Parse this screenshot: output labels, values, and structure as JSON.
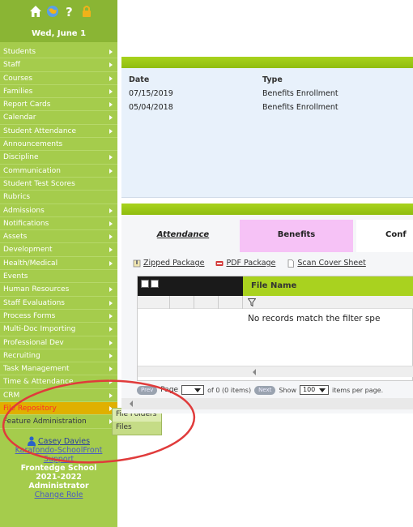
{
  "sidebar": {
    "date": "Wed, June 1",
    "items": [
      {
        "label": "Students",
        "arrow": true
      },
      {
        "label": "Staff",
        "arrow": true
      },
      {
        "label": "Courses",
        "arrow": true
      },
      {
        "label": "Families",
        "arrow": true
      },
      {
        "label": "Report Cards",
        "arrow": true
      },
      {
        "label": "Calendar",
        "arrow": true
      },
      {
        "label": "Student Attendance",
        "arrow": true
      },
      {
        "label": "Announcements",
        "arrow": false
      },
      {
        "label": "Discipline",
        "arrow": true
      },
      {
        "label": "Communication",
        "arrow": true
      },
      {
        "label": "Student Test Scores",
        "arrow": false
      },
      {
        "label": "Rubrics",
        "arrow": false
      },
      {
        "label": "Admissions",
        "arrow": true
      },
      {
        "label": "Notifications",
        "arrow": true
      },
      {
        "label": "Assets",
        "arrow": true
      },
      {
        "label": "Development",
        "arrow": true
      },
      {
        "label": "Health/Medical",
        "arrow": true
      },
      {
        "label": "Events",
        "arrow": false
      },
      {
        "label": "Human Resources",
        "arrow": true
      },
      {
        "label": "Staff Evaluations",
        "arrow": true
      },
      {
        "label": "Process Forms",
        "arrow": true
      },
      {
        "label": "Multi-Doc Importing",
        "arrow": true
      },
      {
        "label": "Professional Dev",
        "arrow": true
      },
      {
        "label": "Recruiting",
        "arrow": true
      },
      {
        "label": "Task Management",
        "arrow": true
      },
      {
        "label": "Time & Attendance",
        "arrow": true
      },
      {
        "label": "CRM",
        "arrow": true
      },
      {
        "label": "File Repository",
        "arrow": true,
        "active": true
      },
      {
        "label": "Feature Administration",
        "arrow": true,
        "dark": true
      }
    ],
    "user_name": "Casey Davies",
    "support": "Karafondo-SchoolFront Support",
    "school": "Frontedge School",
    "year": "2021-2022",
    "role": "Administrator",
    "change_role": "Change Role"
  },
  "flyout": {
    "items": [
      "File Folders",
      "Files"
    ]
  },
  "records": {
    "headers": {
      "date": "Date",
      "type": "Type"
    },
    "rows": [
      {
        "date": "07/15/2019",
        "type": "Benefits Enrollment"
      },
      {
        "date": "05/04/2018",
        "type": "Benefits Enrollment"
      }
    ]
  },
  "tabs": {
    "attendance": "Attendance",
    "benefits": "Benefits",
    "conf": "Conf"
  },
  "toolbar": {
    "zipped": "Zipped Package",
    "pdf": "PDF Package",
    "scan": "Scan Cover Sheet"
  },
  "grid": {
    "column": "File Name",
    "empty": "No records match the filter spe"
  },
  "pager": {
    "prev": "Prev",
    "page": "Page",
    "of": "of 0 (0 items)",
    "next": "Next",
    "show": "Show",
    "size": "100",
    "per_page": "items per page."
  },
  "colors": {
    "sidebar": "#a5cc4c",
    "accent_green": "#a9d21f",
    "active_item": "#e0b000",
    "tab_benefits": "#f6c2f6",
    "annotation": "#e03b3b"
  }
}
